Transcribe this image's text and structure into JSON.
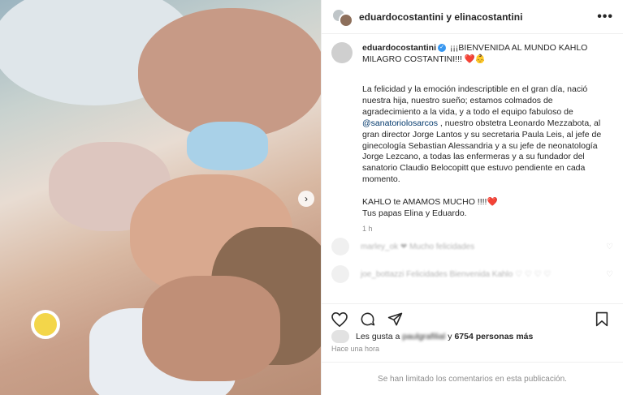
{
  "header": {
    "user1": "eduardocostantini",
    "joiner": "y",
    "user2": "elinacostantini",
    "more": "•••"
  },
  "caption": {
    "username": "eduardocostantini",
    "headline": "¡¡¡BIENVENIDA AL MUNDO KAHLO MILAGRO COSTANTINI!!! ❤️👶",
    "para1_a": "La felicidad y la emoción indescriptible en el gran día, nació nuestra hija, nuestro sueño; estamos colmados de agradecimiento a la vida, y a todo el equipo fabuloso de ",
    "mention": "@sanatoriolosarcos",
    "para1_b": " , nuestro obstetra Leonardo Mezzabota, al gran director Jorge Lantos y su secretaria Paula Leis, al jefe de ginecología Sebastian Alessandria y a su jefe de neonatología Jorge Lezcano, a todas las enfermeras y a su fundador del sanatorio Claudio Belocopitt que estuvo pendiente en cada momento.",
    "para2": "KAHLO te AMAMOS MUCHO !!!!❤️",
    "para3": "Tus papas Elina y Eduardo.",
    "time": "1 h"
  },
  "comments": [
    {
      "text": "marley_ok ❤ Mucho felicidades",
      "heart": "♡"
    },
    {
      "text": "joe_bottazzi Felicidades Bienvenida Kahlo ♡ ♡ ♡ ♡",
      "heart": "♡"
    }
  ],
  "likes": {
    "prefix": "Les gusta a",
    "blurred_user": "paulgrafilial",
    "middle": "y",
    "count": "6754 personas más"
  },
  "posted": "Hace una hora",
  "limited_notice": "Se han limitado los comentarios en esta publicación.",
  "icons": {
    "like": "heart-icon",
    "comment": "comment-icon",
    "share": "share-icon",
    "save": "bookmark-icon",
    "next": "chevron-right-icon"
  },
  "colors": {
    "verified": "#3897f0",
    "mention": "#00376b",
    "muted": "#8e8e8e"
  }
}
